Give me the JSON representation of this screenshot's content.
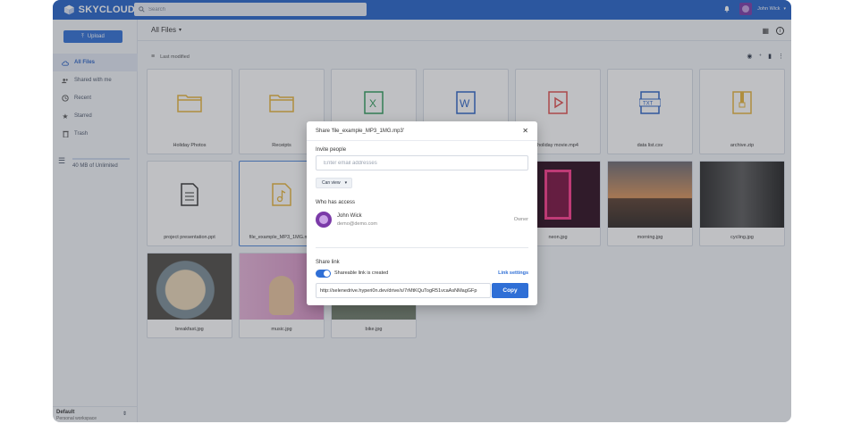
{
  "app": {
    "brand": "SKYCLOUD",
    "search_placeholder": "Search",
    "user_name": "John Wick"
  },
  "sidebar": {
    "upload_label": "Upload",
    "items": [
      {
        "label": "All Files",
        "icon": "cloud-icon",
        "active": true
      },
      {
        "label": "Shared with me",
        "icon": "users-icon"
      },
      {
        "label": "Recent",
        "icon": "clock-icon"
      },
      {
        "label": "Starred",
        "icon": "star-icon"
      },
      {
        "label": "Trash",
        "icon": "trash-icon"
      }
    ],
    "storage": "40 MB of Unlimited",
    "workspace_name": "Default",
    "workspace_sub": "Personal workspace"
  },
  "main": {
    "title": "All Files",
    "sort_label": "Last modified"
  },
  "files": [
    {
      "name": "Holiday Photos",
      "type": "folder",
      "color": "#e8b53a"
    },
    {
      "name": "Receipts",
      "type": "folder",
      "color": "#e8b53a"
    },
    {
      "name": "",
      "type": "excel",
      "color": "#2e9b5a"
    },
    {
      "name": "",
      "type": "word",
      "color": "#2b63c6"
    },
    {
      "name": "holiday movie.mp4",
      "type": "video",
      "color": "#e24c4c"
    },
    {
      "name": "data list.csv",
      "type": "txt",
      "color": "#2b63c6"
    },
    {
      "name": "archive.zip",
      "type": "zip",
      "color": "#e8b53a"
    },
    {
      "name": "project presentation.ppt",
      "type": "doc",
      "color": "#333333"
    },
    {
      "name": "file_example_MP3_1MG.mp3",
      "type": "audio",
      "color": "#e8b53a"
    },
    {
      "name": "",
      "type": "image"
    },
    {
      "name": "",
      "type": "image"
    },
    {
      "name": "neon.jpg",
      "type": "image",
      "color": "#e8287a"
    },
    {
      "name": "morning.jpg",
      "type": "image",
      "color": "#b0683a"
    },
    {
      "name": "cycling.jpg",
      "type": "image",
      "color": "#3a3a3a"
    },
    {
      "name": "breakfast.jpg",
      "type": "image",
      "color": "#c89560"
    },
    {
      "name": "music.jpg",
      "type": "image",
      "color": "#d58fc2"
    },
    {
      "name": "bike.jpg",
      "type": "image",
      "color": "#6e7d6a"
    }
  ],
  "modal": {
    "title": "Share 'file_example_MP3_1MG.mp3'",
    "invite_label": "Invite people",
    "invite_placeholder": "Enter email addresses",
    "permission": "Can view",
    "access_label": "Who has access",
    "user_name": "John Wick",
    "user_email": "demo@demo.com",
    "user_role": "Owner",
    "share_link_label": "Share link",
    "shareable_text": "Shareable link is created",
    "link_settings": "Link settings",
    "link_url": "http://selenedrive.hyperi0n.dev/drive/s/7rMtKQuTogR51vcaAsNMagGFp",
    "copy_label": "Copy"
  }
}
